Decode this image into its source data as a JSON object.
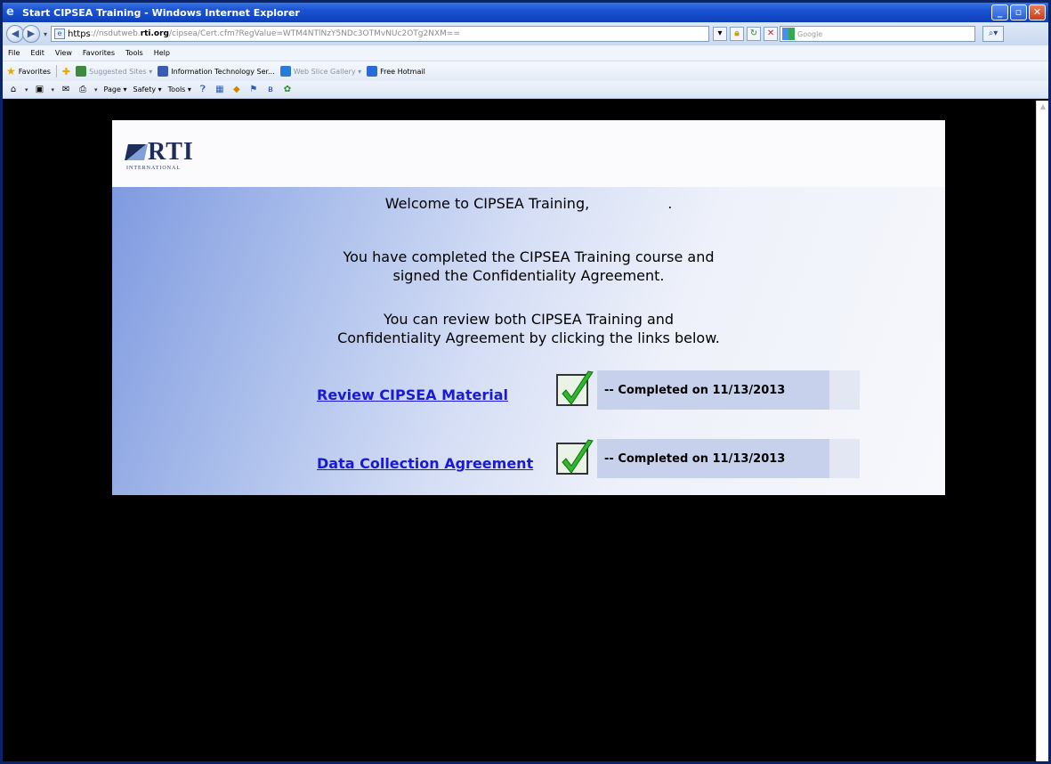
{
  "window": {
    "title": "Start CIPSEA Training - Windows Internet Explorer",
    "controls": {
      "minimize": "_",
      "maximize": "▫",
      "close": "✕"
    }
  },
  "address_bar": {
    "scheme": "https",
    "url_prefix": "://nsdutweb.",
    "url_domain": "rti.org",
    "url_rest": "/cipsea/Cert.cfm?RegValue=WTM4NTlNzY5NDc3OTMvNUc2OTg2NXM==",
    "search_placeholder": "Google"
  },
  "menu": [
    "File",
    "Edit",
    "View",
    "Favorites",
    "Tools",
    "Help"
  ],
  "favorites": {
    "label": "Favorites",
    "items": [
      {
        "label": "Suggested Sites ▾",
        "muted": true,
        "color": "#3c8a3c"
      },
      {
        "label": "Information Technology Ser...",
        "muted": false,
        "color": "#3a5ab8"
      },
      {
        "label": "Web Slice Gallery ▾",
        "muted": true,
        "color": "#2a7ad8"
      },
      {
        "label": "Free Hotmail",
        "muted": false,
        "color": "#2a6ad8"
      }
    ]
  },
  "command_bar": [
    "Page ▾",
    "Safety ▾",
    "Tools ▾"
  ],
  "page": {
    "logo": {
      "mark": "RTI",
      "sub": "INTERNATIONAL"
    },
    "welcome": "Welcome to CIPSEA Training,",
    "welcome_suffix": ".",
    "completed_line1": "You have completed the CIPSEA Training course and",
    "completed_line2": "signed the Confidentiality Agreement.",
    "review_line1": "You can review both CIPSEA Training and",
    "review_line2": "Confidentiality Agreement by clicking the links below.",
    "links": [
      {
        "label": "Review CIPSEA Material",
        "status": "-- Completed on 11/13/2013"
      },
      {
        "label": "Data Collection Agreement",
        "status": "-- Completed on 11/13/2013"
      }
    ]
  },
  "colors": {
    "link": "#1a1ad6",
    "titlebar": "#1b55d6",
    "check": "#2eb82e"
  }
}
